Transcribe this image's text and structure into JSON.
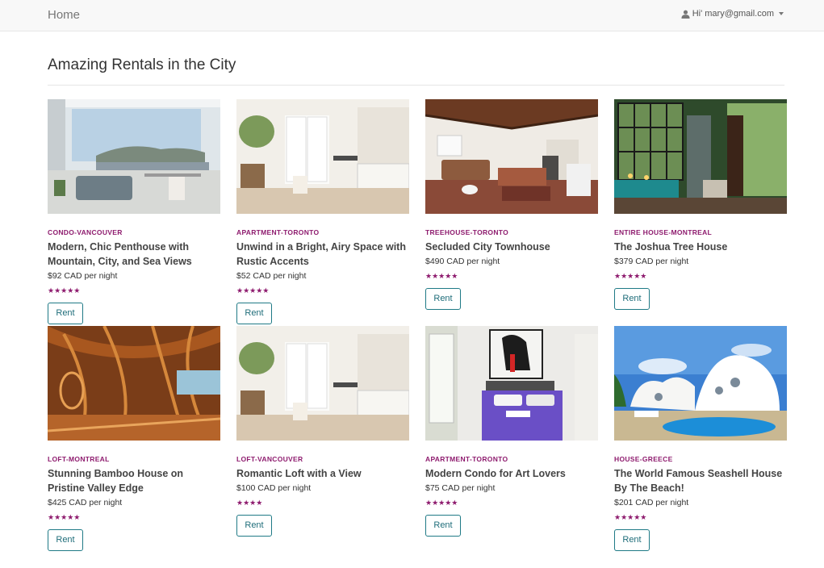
{
  "navbar": {
    "brand": "Home",
    "user_label": "Hi' mary@gmail.com"
  },
  "page": {
    "title": "Amazing Rentals in the City"
  },
  "colors": {
    "accent": "#8e1b6e",
    "button": "#1f7a86",
    "navbar_bg": "#f8f8f8"
  },
  "listings": [
    {
      "category": "CONDO-VANCOUVER",
      "name": "Modern, Chic Penthouse with Mountain, City, and Sea Views",
      "price": "$92 CAD per night",
      "rating": 5,
      "stars": "★★★★★",
      "button": "Rent",
      "image": "penthouse-photo"
    },
    {
      "category": "APARTMENT-TORONTO",
      "name": "Unwind in a Bright, Airy Space with Rustic Accents",
      "price": "$52 CAD per night",
      "rating": 5,
      "stars": "★★★★★",
      "button": "Rent",
      "image": "bright-kitchen-photo"
    },
    {
      "category": "TREEHOUSE-TORONTO",
      "name": "Secluded City Townhouse",
      "price": "$490 CAD per night",
      "rating": 5,
      "stars": "★★★★★",
      "button": "Rent",
      "image": "townhouse-living-room-photo"
    },
    {
      "category": "ENTIRE HOUSE-MONTREAL",
      "name": "The Joshua Tree House",
      "price": "$379 CAD per night",
      "rating": 5,
      "stars": "★★★★★",
      "button": "Rent",
      "image": "joshua-tree-house-photo"
    },
    {
      "category": "LOFT-MONTREAL",
      "name": "Stunning Bamboo House on Pristine Valley Edge",
      "price": "$425 CAD per night",
      "rating": 5,
      "stars": "★★★★★",
      "button": "Rent",
      "image": "bamboo-house-photo"
    },
    {
      "category": "LOFT-VANCOUVER",
      "name": "Romantic Loft with a View",
      "price": "$100 CAD per night",
      "rating": 4,
      "stars": "★★★★",
      "button": "Rent",
      "image": "loft-kitchen-photo"
    },
    {
      "category": "APARTMENT-TORONTO",
      "name": "Modern Condo for Art Lovers",
      "price": "$75 CAD per night",
      "rating": 5,
      "stars": "★★★★★",
      "button": "Rent",
      "image": "art-bedroom-photo"
    },
    {
      "category": "HOUSE-GREECE",
      "name": "The World Famous Seashell House By The Beach!",
      "price": "$201 CAD per night",
      "rating": 5,
      "stars": "★★★★★",
      "button": "Rent",
      "image": "seashell-house-photo"
    }
  ]
}
